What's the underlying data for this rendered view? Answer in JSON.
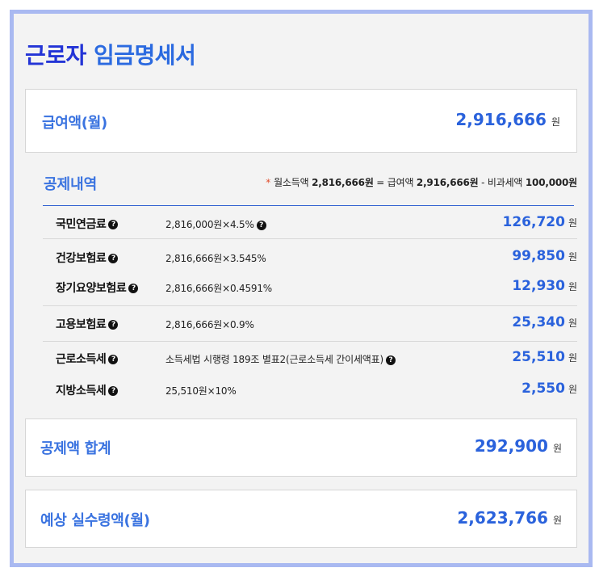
{
  "title": {
    "main": "근로자",
    "sub": "임금명세서"
  },
  "salary": {
    "label": "급여액(월)",
    "value": "2,916,666",
    "unit": "원"
  },
  "deductions": {
    "header": "공제내역",
    "formula": {
      "star": "*",
      "prefix": "월소득액",
      "monthly_income": "2,816,666원",
      "eq": "= 급여액",
      "salary": "2,916,666원",
      "minus": "- 비과세액",
      "nontax": "100,000원"
    },
    "items": [
      {
        "name": "국민연금료",
        "calc": "2,816,000원×4.5%",
        "calc_help": true,
        "amount": "126,720",
        "unit": "원"
      },
      {
        "name": "건강보험료",
        "calc": "2,816,666원×3.545%",
        "calc_help": false,
        "amount": "99,850",
        "unit": "원"
      },
      {
        "name": "장기요양보험료",
        "calc": "2,816,666원×0.4591%",
        "calc_help": false,
        "amount": "12,930",
        "unit": "원"
      },
      {
        "name": "고용보험료",
        "calc": "2,816,666원×0.9%",
        "calc_help": false,
        "amount": "25,340",
        "unit": "원"
      },
      {
        "name": "근로소득세",
        "calc": "소득세법 시행령 189조 별표2(근로소득세 간이세액표)",
        "calc_help": true,
        "amount": "25,510",
        "unit": "원"
      },
      {
        "name": "지방소득세",
        "calc": "25,510원×10%",
        "calc_help": false,
        "amount": "2,550",
        "unit": "원"
      }
    ],
    "help_icon": "question-circle-icon"
  },
  "total": {
    "label": "공제액 합계",
    "value": "292,900",
    "unit": "원"
  },
  "net": {
    "label": "예상 실수령액(월)",
    "value": "2,623,766",
    "unit": "원"
  }
}
